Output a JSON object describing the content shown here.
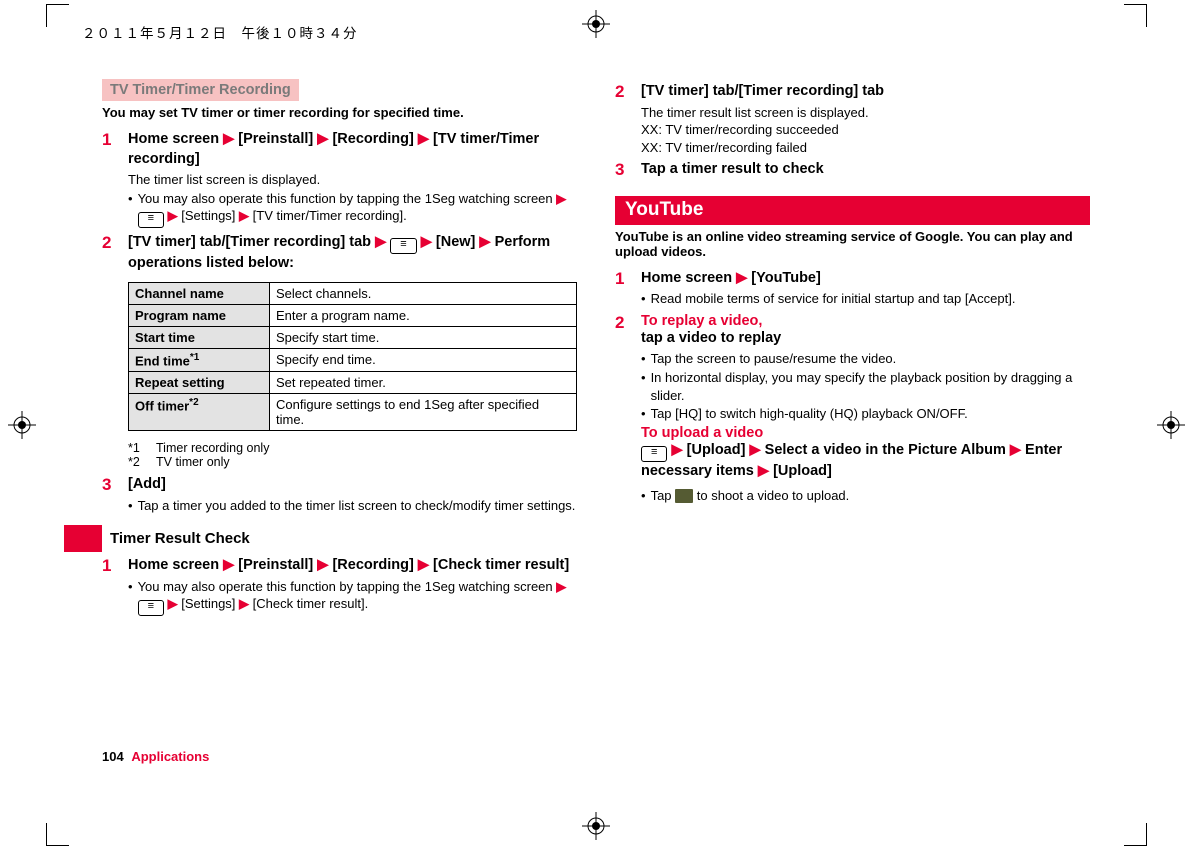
{
  "meta": {
    "datetime": "２０１１年５月１２日　午後１０時３４分"
  },
  "left": {
    "section_title": "TV Timer/Timer Recording",
    "intro": "You may set TV timer or timer recording for specified time.",
    "steps": {
      "s1": {
        "num": "1",
        "title_parts": [
          "Home screen ",
          " [Preinstall] ",
          " [Recording] ",
          " [TV timer/Timer recording]"
        ],
        "desc": "The timer list screen is displayed.",
        "alt_a": "You may also operate this function by tapping the 1Seg watching screen ",
        "alt_b": " [Settings] ",
        "alt_c": " [TV timer/Timer recording]."
      },
      "s2": {
        "num": "2",
        "title_a": "[TV timer] tab/[Timer recording] tab ",
        "title_b": " [New] ",
        "title_c": " Perform operations listed below:"
      },
      "s3": {
        "num": "3",
        "title": "[Add]",
        "bullet": "Tap a timer you added to the timer list screen to check/modify timer settings."
      }
    },
    "table": {
      "rows": [
        {
          "k": "Channel name",
          "v": "Select channels."
        },
        {
          "k": "Program name",
          "v": "Enter a program name."
        },
        {
          "k": "Start time",
          "v": "Specify start time."
        },
        {
          "k": "End time",
          "sup": "*1",
          "v": "Specify end time."
        },
        {
          "k": "Repeat setting",
          "v": "Set repeated timer."
        },
        {
          "k": "Off timer",
          "sup": "*2",
          "v": "Configure settings to end 1Seg after specified time."
        }
      ]
    },
    "footnotes": [
      {
        "label": "*1",
        "text": "Timer recording only"
      },
      {
        "label": "*2",
        "text": "TV timer only"
      }
    ],
    "subhead": "Timer Result Check",
    "trc": {
      "s1": {
        "num": "1",
        "title_parts": [
          "Home screen ",
          " [Preinstall] ",
          " [Recording] ",
          " [Check timer result]"
        ],
        "alt_a": "You may also operate this function by tapping the 1Seg watching screen ",
        "alt_b": " [Settings] ",
        "alt_c": " [Check timer result]."
      }
    }
  },
  "right": {
    "top": {
      "s2": {
        "num": "2",
        "title": "[TV timer] tab/[Timer recording] tab",
        "l1": "The timer result list screen is displayed.",
        "l2": "XX: TV timer/recording succeeded",
        "l3": "XX: TV timer/recording failed"
      },
      "s3": {
        "num": "3",
        "title": "Tap a timer result to check"
      }
    },
    "youtube": {
      "bar": "YouTube",
      "intro": "YouTube is an online video streaming service of Google. You can play and upload videos.",
      "s1": {
        "num": "1",
        "title_parts": [
          "Home screen ",
          " [YouTube]"
        ],
        "bullet": "Read mobile terms of service for initial startup and tap [Accept]."
      },
      "s2": {
        "num": "2",
        "red_line": "To replay a video,",
        "bold_line": "tap a video to replay",
        "b1": "Tap the screen to pause/resume the video.",
        "b2": "In horizontal display, you may specify the playback position by dragging a slider.",
        "b3": "Tap [HQ] to switch high-quality (HQ) playback ON/OFF.",
        "upload_red": "To upload a video",
        "upload_line_a": " [Upload] ",
        "upload_line_b": " Select a video in the Picture Album ",
        "upload_line_c": " Enter necessary items ",
        "upload_line_d": " [Upload]",
        "tap_cam_a": "Tap ",
        "tap_cam_b": " to shoot a video to upload."
      }
    }
  },
  "footer": {
    "pagenum": "104",
    "section": "Applications"
  },
  "glyphs": {
    "arrow": "▶",
    "menu": "≡"
  }
}
